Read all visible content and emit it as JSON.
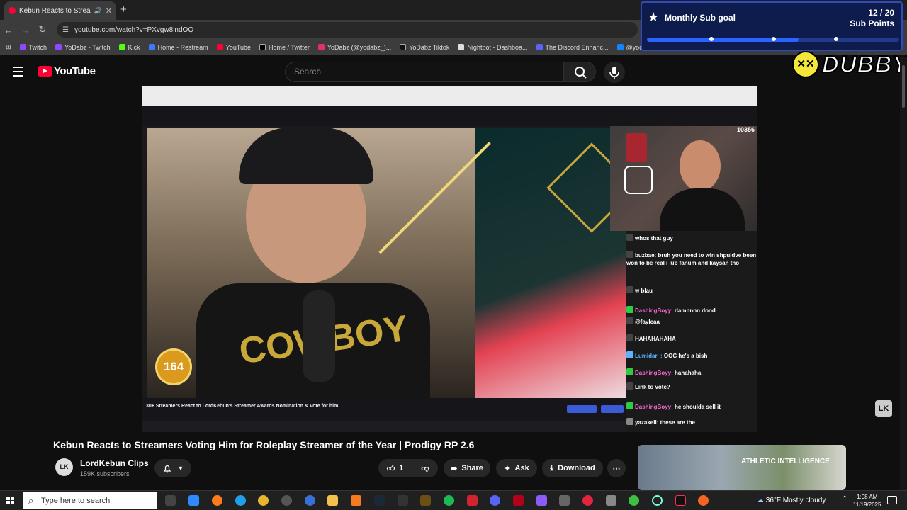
{
  "browser": {
    "tab_title": "Kebun Reacts to Streamers",
    "url": "youtube.com/watch?v=PXvgw8lndOQ",
    "bookmarks": [
      "Twitch",
      "YoDabz - Twitch",
      "Kick",
      "Home - Restream",
      "YouTube",
      "Home / Twitter",
      "YoDabz (@yodabz_)...",
      "YoDabz Tiktok",
      "Nightbot - Dashboa...",
      "The Discord Enhanc...",
      "@yodabz.bsky.socia..."
    ]
  },
  "overlay": {
    "goal_label": "Monthly Sub goal",
    "goal_count": "12 / 20",
    "goal_unit": "Sub Points",
    "goal_progress": 0.6,
    "dubby_text": "DUBBY"
  },
  "youtube": {
    "logo_text": "YouTube",
    "search_placeholder": "Search"
  },
  "video": {
    "badge_value": "164",
    "viewer_count": "10356",
    "shirt_text": "COWBOY",
    "inner_title": "30+ Streamers React to LordKebun's Streamer Awards Nomination & Vote for him",
    "chat": [
      {
        "user": "",
        "msg": "whos that guy",
        "cls": "red"
      },
      {
        "user": "buzbae:",
        "msg": " bruh you need to win shpuldve been won to be real i lub fanum and kaysan tho",
        "cls": "white"
      },
      {
        "user": "",
        "msg": "w blau",
        "cls": "red"
      },
      {
        "user": "DashingBoyy:",
        "msg": " damnnnn dood",
        "cls": ""
      },
      {
        "user": "@fayleaa",
        "msg": "",
        "cls": "white"
      },
      {
        "user": "",
        "msg": "HAHAHAHAHA",
        "cls": "red"
      },
      {
        "user": "Lumidar_:",
        "msg": " OOC he's a bish",
        "cls": "blue"
      },
      {
        "user": "DashingBoyy:",
        "msg": " hahahaha",
        "cls": ""
      },
      {
        "user": "",
        "msg": "Link to vote?",
        "cls": "red"
      },
      {
        "user": "DashingBoyy:",
        "msg": " he shoulda sell it",
        "cls": ""
      },
      {
        "user": "yazakeli:",
        "msg": " these are the",
        "cls": "white"
      }
    ]
  },
  "meta": {
    "title": "Kebun Reacts to Streamers Voting Him for Roleplay Streamer of the Year | Prodigy RP 2.6",
    "channel": "LordKebun Clips",
    "subscribers": "159K subscribers",
    "likes": "1",
    "share_label": "Share",
    "ask_label": "Ask",
    "download_label": "Download",
    "ad_text": "ATHLETIC INTELLIGENCE"
  },
  "taskbar": {
    "search_placeholder": "Type here to search",
    "weather": "36°F  Mostly cloudy",
    "time": "1:08 AM",
    "date": "11/19/2025"
  },
  "colors": {
    "youtube_red": "#ff0033",
    "overlay_blue": "#2a63ff",
    "overlay_bg": "#0d1b4d"
  }
}
